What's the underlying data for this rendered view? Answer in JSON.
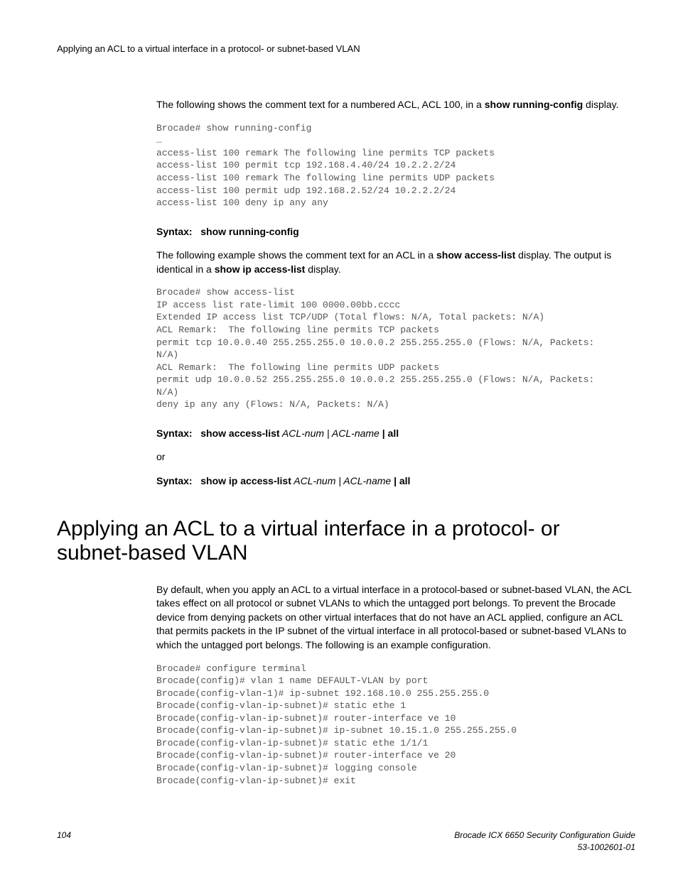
{
  "header": "Applying an ACL to a virtual interface in a protocol- or subnet-based VLAN",
  "intro1_a": "The following shows the comment text for a numbered ACL, ACL 100, in a ",
  "intro1_b": "show running-config",
  "intro1_c": " display.",
  "code1": "Brocade# show running-config\n…\naccess-list 100 remark The following line permits TCP packets\naccess-list 100 permit tcp 192.168.4.40/24 10.2.2.2/24\naccess-list 100 remark The following line permits UDP packets\naccess-list 100 permit udp 192.168.2.52/24 10.2.2.2/24\naccess-list 100 deny ip any any",
  "syntax1_label": "Syntax:",
  "syntax1_cmd": "show running-config",
  "intro2_a": "The following example shows the comment text for an ACL in a ",
  "intro2_b": "show access-list",
  "intro2_c": " display. The output is identical in a ",
  "intro2_d": "show ip access-list",
  "intro2_e": " display.",
  "code2": "Brocade# show access-list\nIP access list rate-limit 100 0000.00bb.cccc\nExtended IP access list TCP/UDP (Total flows: N/A, Total packets: N/A)\nACL Remark:  The following line permits TCP packets\npermit tcp 10.0.0.40 255.255.255.0 10.0.0.2 255.255.255.0 (Flows: N/A, Packets:\nN/A)\nACL Remark:  The following line permits UDP packets\npermit udp 10.0.0.52 255.255.255.0 10.0.0.2 255.255.255.0 (Flows: N/A, Packets:\nN/A)\ndeny ip any any (Flows: N/A, Packets: N/A)",
  "syntax2_label": "Syntax:",
  "syntax2_cmd": "show access-list",
  "syntax2_arg": " ACL-num | ACL-name ",
  "syntax2_all": "| all",
  "or_text": "or",
  "syntax3_label": "Syntax:",
  "syntax3_cmd": "show ip access-list",
  "syntax3_arg": " ACL-num | ACL-name ",
  "syntax3_all": "| all",
  "section_title": "Applying an ACL to a virtual interface in a protocol- or subnet-based VLAN",
  "body_para": "By default, when you apply an ACL to a virtual interface in a protocol-based or subnet-based VLAN, the ACL takes effect on all protocol or subnet VLANs to which the untagged port belongs.  To prevent the Brocade device from denying packets on other virtual interfaces that do not have an ACL applied, configure an ACL that permits packets in the IP subnet of the virtual interface in all protocol-based or subnet-based VLANs to which the untagged port belongs.  The following is an example configuration.",
  "code3": "Brocade# configure terminal\nBrocade(config)# vlan 1 name DEFAULT-VLAN by port\nBrocade(config-vlan-1)# ip-subnet 192.168.10.0 255.255.255.0\nBrocade(config-vlan-ip-subnet)# static ethe 1\nBrocade(config-vlan-ip-subnet)# router-interface ve 10\nBrocade(config-vlan-ip-subnet)# ip-subnet 10.15.1.0 255.255.255.0\nBrocade(config-vlan-ip-subnet)# static ethe 1/1/1\nBrocade(config-vlan-ip-subnet)# router-interface ve 20\nBrocade(config-vlan-ip-subnet)# logging console\nBrocade(config-vlan-ip-subnet)# exit",
  "footer_page": "104",
  "footer_doc1": "Brocade ICX 6650 Security Configuration Guide",
  "footer_doc2": "53-1002601-01"
}
